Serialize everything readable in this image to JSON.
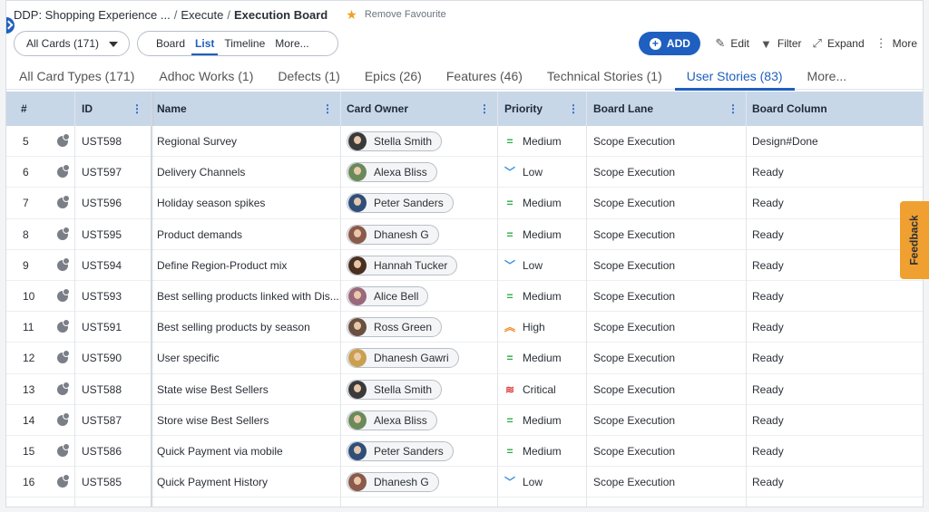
{
  "breadcrumb": {
    "project": "DDP: Shopping Experience ...",
    "section": "Execute",
    "current": "Execution Board",
    "favourite_label": "Remove Favourite"
  },
  "toolbar": {
    "cards_filter": "All Cards (171)",
    "views": [
      "Board",
      "List",
      "Timeline",
      "More..."
    ],
    "active_view": "List",
    "add_label": "ADD",
    "edit_label": "Edit",
    "filter_label": "Filter",
    "expand_label": "Expand",
    "more_label": "More"
  },
  "tabs": [
    {
      "label": "All Card Types (171)"
    },
    {
      "label": "Adhoc Works (1)"
    },
    {
      "label": "Defects (1)"
    },
    {
      "label": "Epics (26)"
    },
    {
      "label": "Features (46)"
    },
    {
      "label": "Technical Stories (1)"
    },
    {
      "label": "User Stories (83)",
      "active": true
    },
    {
      "label": "More..."
    }
  ],
  "columns": {
    "num": "#",
    "id": "ID",
    "name": "Name",
    "owner": "Card Owner",
    "priority": "Priority",
    "lane": "Board Lane",
    "column": "Board Column"
  },
  "rows": [
    {
      "num": "5",
      "id": "UST598",
      "name": "Regional Survey",
      "owner": "Stella Smith",
      "avatar_color": "#3a3a3a",
      "priority": "Medium",
      "lane": "Scope Execution",
      "column": "Design#Done"
    },
    {
      "num": "6",
      "id": "UST597",
      "name": "Delivery Channels",
      "owner": "Alexa Bliss",
      "avatar_color": "#6b8a5a",
      "priority": "Low",
      "lane": "Scope Execution",
      "column": "Ready"
    },
    {
      "num": "7",
      "id": "UST596",
      "name": "Holiday season spikes",
      "owner": "Peter Sanders",
      "avatar_color": "#2f4f7a",
      "priority": "Medium",
      "lane": "Scope Execution",
      "column": "Ready"
    },
    {
      "num": "8",
      "id": "UST595",
      "name": "Product demands",
      "owner": "Dhanesh G",
      "avatar_color": "#8a5a4a",
      "priority": "Medium",
      "lane": "Scope Execution",
      "column": "Ready"
    },
    {
      "num": "9",
      "id": "UST594",
      "name": "Define Region-Product mix",
      "owner": "Hannah Tucker",
      "avatar_color": "#4a3020",
      "priority": "Low",
      "lane": "Scope Execution",
      "column": "Ready"
    },
    {
      "num": "10",
      "id": "UST593",
      "name": "Best selling products linked with Dis...",
      "owner": "Alice Bell",
      "avatar_color": "#9a6a7a",
      "priority": "Medium",
      "lane": "Scope Execution",
      "column": "Ready"
    },
    {
      "num": "11",
      "id": "UST591",
      "name": "Best selling products by season",
      "owner": "Ross Green",
      "avatar_color": "#6a5040",
      "priority": "High",
      "lane": "Scope Execution",
      "column": "Ready"
    },
    {
      "num": "12",
      "id": "UST590",
      "name": "User specific",
      "owner": "Dhanesh Gawri",
      "avatar_color": "#c8a050",
      "priority": "Medium",
      "lane": "Scope Execution",
      "column": "Ready"
    },
    {
      "num": "13",
      "id": "UST588",
      "name": "State wise Best Sellers",
      "owner": "Stella Smith",
      "avatar_color": "#3a3a3a",
      "priority": "Critical",
      "lane": "Scope Execution",
      "column": "Ready"
    },
    {
      "num": "14",
      "id": "UST587",
      "name": "Store wise Best Sellers",
      "owner": "Alexa Bliss",
      "avatar_color": "#6b8a5a",
      "priority": "Medium",
      "lane": "Scope Execution",
      "column": "Ready"
    },
    {
      "num": "15",
      "id": "UST586",
      "name": "Quick Payment via mobile",
      "owner": "Peter Sanders",
      "avatar_color": "#2f4f7a",
      "priority": "Medium",
      "lane": "Scope Execution",
      "column": "Ready"
    },
    {
      "num": "16",
      "id": "UST585",
      "name": "Quick Payment History",
      "owner": "Dhanesh G",
      "avatar_color": "#8a5a4a",
      "priority": "Low",
      "lane": "Scope Execution",
      "column": "Ready"
    }
  ],
  "priority_icons": {
    "Medium": {
      "glyph": "=",
      "icon": "medium-priority-icon"
    },
    "Low": {
      "glyph": "﹀",
      "icon": "low-priority-icon"
    },
    "High": {
      "glyph": "︽",
      "icon": "high-priority-icon"
    },
    "Critical": {
      "glyph": "≋",
      "icon": "critical-priority-icon"
    }
  },
  "feedback_label": "Feedback"
}
